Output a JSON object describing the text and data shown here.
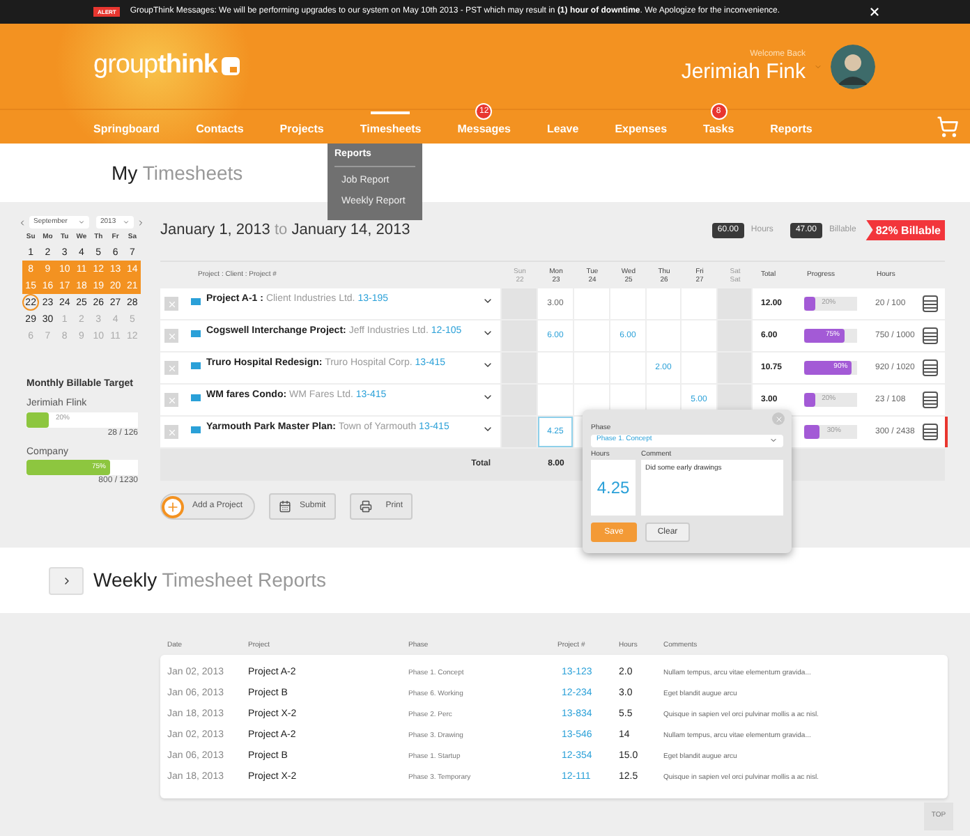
{
  "alert": {
    "tag": "ALERT",
    "message": "GroupThink Messages: We will be performing upgrades to our system on May 10th 2013 - PST which may result in **(1) hour of downtime**. We Apologize for the inconvenience."
  },
  "header": {
    "logo": "group**think**",
    "welcome": "Welcome Back",
    "user": "Jerimiah Fink"
  },
  "nav": [
    {
      "label": "Springboard",
      "selected": false
    },
    {
      "label": "Contacts",
      "selected": false
    },
    {
      "label": "Projects",
      "selected": false
    },
    {
      "label": "Timesheets",
      "selected": true
    },
    {
      "label": "Messages",
      "selected": false,
      "badge": "12"
    },
    {
      "label": "Leave",
      "selected": false
    },
    {
      "label": "Expenses",
      "selected": false
    },
    {
      "label": "Tasks",
      "selected": false,
      "badge": "8"
    },
    {
      "label": "Reports",
      "selected": false
    }
  ],
  "dropdown": {
    "heading": "Reports",
    "items": [
      "Job Report",
      "Weekly Report"
    ]
  },
  "page_title": {
    "lead": "My",
    "rest": "Timesheets"
  },
  "calendar": {
    "month": "September",
    "year": "2013",
    "weekdays": [
      "Su",
      "Mo",
      "Tu",
      "We",
      "Th",
      "Fr",
      "Sa"
    ],
    "weeks": [
      {
        "selected": false,
        "days": [
          {
            "label": "1",
            "muted": false,
            "today": false
          },
          {
            "label": "2",
            "muted": false,
            "today": false
          },
          {
            "label": "3",
            "muted": false,
            "today": false
          },
          {
            "label": "4",
            "muted": false,
            "today": false
          },
          {
            "label": "5",
            "muted": false,
            "today": false
          },
          {
            "label": "6",
            "muted": false,
            "today": false
          },
          {
            "label": "7",
            "muted": false,
            "today": false
          }
        ]
      },
      {
        "selected": true,
        "days": [
          {
            "label": "8",
            "muted": false,
            "today": false
          },
          {
            "label": "9",
            "muted": false,
            "today": false
          },
          {
            "label": "10",
            "muted": false,
            "today": false
          },
          {
            "label": "11",
            "muted": false,
            "today": false
          },
          {
            "label": "12",
            "muted": false,
            "today": false
          },
          {
            "label": "13",
            "muted": false,
            "today": false
          },
          {
            "label": "14",
            "muted": false,
            "today": false
          }
        ]
      },
      {
        "selected": true,
        "days": [
          {
            "label": "15",
            "muted": false,
            "today": false
          },
          {
            "label": "16",
            "muted": false,
            "today": false
          },
          {
            "label": "17",
            "muted": false,
            "today": false
          },
          {
            "label": "18",
            "muted": false,
            "today": false
          },
          {
            "label": "19",
            "muted": false,
            "today": false
          },
          {
            "label": "20",
            "muted": false,
            "today": false
          },
          {
            "label": "21",
            "muted": false,
            "today": false
          }
        ]
      },
      {
        "selected": false,
        "days": [
          {
            "label": "22",
            "muted": false,
            "today": true
          },
          {
            "label": "23",
            "muted": false,
            "today": false
          },
          {
            "label": "24",
            "muted": false,
            "today": false
          },
          {
            "label": "25",
            "muted": false,
            "today": false
          },
          {
            "label": "26",
            "muted": false,
            "today": false
          },
          {
            "label": "27",
            "muted": false,
            "today": false
          },
          {
            "label": "28",
            "muted": false,
            "today": false
          }
        ]
      },
      {
        "selected": false,
        "days": [
          {
            "label": "29",
            "muted": false,
            "today": false
          },
          {
            "label": "30",
            "muted": false,
            "today": false
          },
          {
            "label": "1",
            "muted": true,
            "today": false
          },
          {
            "label": "2",
            "muted": true,
            "today": false
          },
          {
            "label": "3",
            "muted": true,
            "today": false
          },
          {
            "label": "4",
            "muted": true,
            "today": false
          },
          {
            "label": "5",
            "muted": true,
            "today": false
          }
        ]
      },
      {
        "selected": false,
        "days": [
          {
            "label": "6",
            "muted": true,
            "today": false
          },
          {
            "label": "7",
            "muted": true,
            "today": false
          },
          {
            "label": "8",
            "muted": true,
            "today": false
          },
          {
            "label": "9",
            "muted": true,
            "today": false
          },
          {
            "label": "10",
            "muted": true,
            "today": false
          },
          {
            "label": "11",
            "muted": true,
            "today": false
          },
          {
            "label": "12",
            "muted": true,
            "today": false
          }
        ]
      }
    ]
  },
  "target": {
    "title": "Monthly Billable Target",
    "people": [
      {
        "name": "Jerimiah Flink",
        "level": 0.2,
        "percent": "20%",
        "reading": "28 / 126"
      },
      {
        "name": "Company",
        "level": 0.75,
        "percent": "75%",
        "reading": "800 / 1230"
      }
    ]
  },
  "range": {
    "from": "January 1, 2013",
    "to": "to",
    "until": "January 14, 2013"
  },
  "summary": {
    "hours": "60.00",
    "hours_label": "Hours",
    "billable": "47.00",
    "billable_label": "Billable",
    "ratio": "82% Billable"
  },
  "table": {
    "project_header": "Project : Client : Project #",
    "days": [
      {
        "name": "Sun",
        "date": "22",
        "weekend": true
      },
      {
        "name": "Mon",
        "date": "23",
        "weekend": false
      },
      {
        "name": "Tue",
        "date": "24",
        "weekend": false
      },
      {
        "name": "Wed",
        "date": "25",
        "weekend": false
      },
      {
        "name": "Thu",
        "date": "26",
        "weekend": false
      },
      {
        "name": "Fri",
        "date": "27",
        "weekend": false
      },
      {
        "name": "Sat",
        "date": "Sat",
        "weekend": true
      }
    ],
    "total_header": "Total",
    "progress_header": "Progress",
    "hours_header": "Hours",
    "rows": [
      {
        "name": "Project A-1 :",
        "client": "Client Industries Ltd.",
        "number": "13-195",
        "entries": [
          {
            "kind": "empty"
          },
          {
            "kind": "hours",
            "value": "3.00"
          },
          {
            "kind": "empty"
          },
          {
            "kind": "empty"
          },
          {
            "kind": "empty"
          },
          {
            "kind": "empty"
          },
          {
            "kind": "empty"
          }
        ],
        "total": "12.00",
        "level": 0.2,
        "percent": "20%",
        "hours": "20 / 100",
        "selected": false
      },
      {
        "name": "Cogswell Interchange Project:",
        "client": "Jeff Industries Ltd.",
        "number": "12-105",
        "entries": [
          {
            "kind": "empty"
          },
          {
            "kind": "hours",
            "value": "6.00"
          },
          {
            "kind": "empty"
          },
          {
            "kind": "hours",
            "value": "6.00"
          },
          {
            "kind": "empty"
          },
          {
            "kind": "empty"
          },
          {
            "kind": "empty"
          }
        ],
        "total": "6.00",
        "level": 0.75,
        "percent": "75%",
        "hours": "750 / 1000",
        "selected": false
      },
      {
        "name": "Truro Hospital Redesign:",
        "client": "Truro Hospital Corp.",
        "number": "13-415",
        "entries": [
          {
            "kind": "empty"
          },
          {
            "kind": "empty"
          },
          {
            "kind": "empty"
          },
          {
            "kind": "empty"
          },
          {
            "kind": "hours",
            "value": "2.00"
          },
          {
            "kind": "empty"
          },
          {
            "kind": "empty"
          }
        ],
        "total": "10.75",
        "level": 0.9,
        "percent": "90%",
        "hours": "920 / 1020",
        "selected": false
      },
      {
        "name": "WM fares Condo:",
        "client": "WM Fares Ltd.",
        "number": "13-415",
        "entries": [
          {
            "kind": "empty"
          },
          {
            "kind": "empty"
          },
          {
            "kind": "empty"
          },
          {
            "kind": "empty"
          },
          {
            "kind": "empty"
          },
          {
            "kind": "hours",
            "value": "5.00"
          },
          {
            "kind": "empty"
          }
        ],
        "total": "3.00",
        "level": 0.2,
        "percent": "20%",
        "hours": "23 / 108",
        "selected": false
      },
      {
        "name": "Yarmouth Park Master Plan:",
        "client": "Town of Yarmouth",
        "number": "13-415",
        "entries": [
          {
            "kind": "empty"
          },
          {
            "kind": "hours",
            "value": "4.25"
          },
          {
            "kind": "empty"
          },
          {
            "kind": "empty"
          },
          {
            "kind": "empty"
          },
          {
            "kind": "empty"
          },
          {
            "kind": "empty"
          }
        ],
        "level": 0.3,
        "percent": "30%",
        "hours": "300 / 2438",
        "selected": true
      }
    ],
    "total_row": {
      "label": "Total",
      "entries": [
        {
          "kind": "empty"
        },
        {
          "kind": "hours",
          "value": "8.00"
        },
        {
          "kind": "empty"
        },
        {
          "kind": "empty"
        },
        {
          "kind": "empty"
        },
        {
          "kind": "empty"
        },
        {
          "kind": "empty"
        }
      ]
    }
  },
  "popup": {
    "phase_label": "Phase",
    "phase": "Phase 1. Concept",
    "hours_label": "Hours",
    "hours": "4.25",
    "comment_label": "Comment",
    "comment": "Did some early drawings",
    "save": "Save",
    "clear": "Clear"
  },
  "actions": {
    "add": "Add a Project",
    "submit": "Submit",
    "print": "Print"
  },
  "reports": {
    "title_lead": "Weekly",
    "title_rest": "Timesheet Reports",
    "columns": [
      "Date",
      "Project",
      "Phase",
      "Project #",
      "Hours",
      "Comments"
    ],
    "rows": [
      [
        "Jan 02, 2013",
        "Project A-2",
        "Phase 1. Concept",
        "13-123",
        "2.0",
        "Nullam tempus, arcu vitae elementum gravida..."
      ],
      [
        "Jan 06, 2013",
        "Project B",
        "Phase 6. Working",
        "12-234",
        "3.0",
        "Eget blandit augue arcu"
      ],
      [
        "Jan 18, 2013",
        "Project X-2",
        "Phase 2. Perc",
        "13-834",
        "5.5",
        "Quisque in sapien vel orci pulvinar mollis a ac nisl."
      ],
      [
        "Jan 02, 2013",
        "Project A-2",
        "Phase 3. Drawing",
        "13-546",
        "14",
        "Nullam tempus, arcu vitae elementum gravida..."
      ],
      [
        "Jan 06, 2013",
        "Project B",
        "Phase 1. Startup",
        "12-354",
        "15.0",
        "Eget blandit augue arcu"
      ],
      [
        "Jan 18, 2013",
        "Project X-2",
        "Phase 3. Temporary",
        "12-111",
        "12.5",
        "Quisque in sapien vel orci pulvinar mollis a ac nisl."
      ]
    ]
  },
  "top": "TOP"
}
